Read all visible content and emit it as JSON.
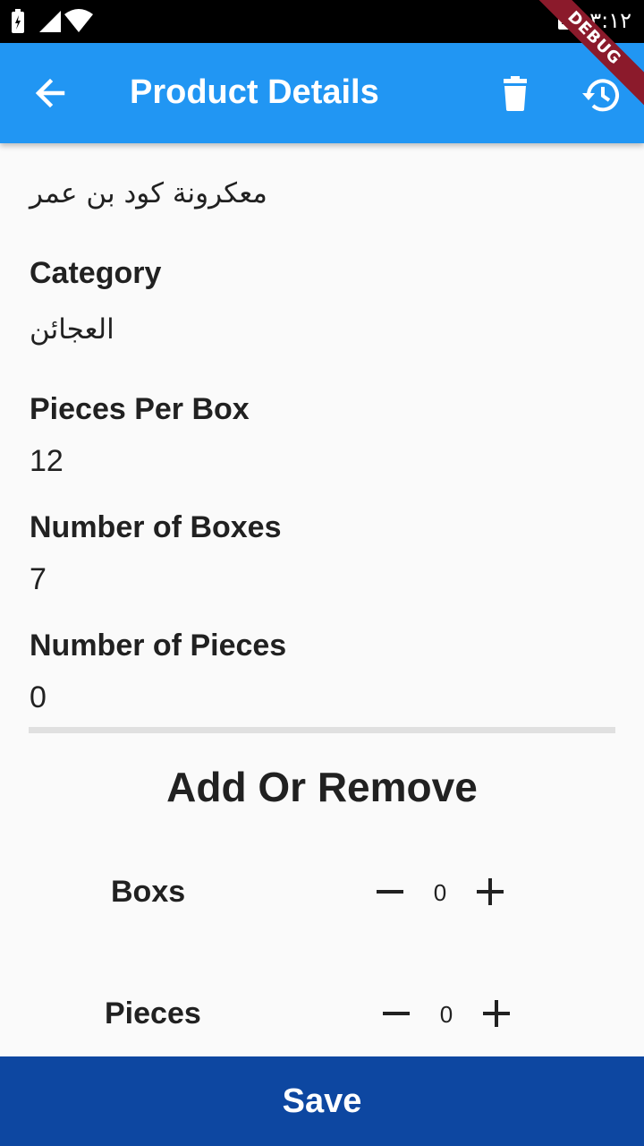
{
  "status_bar": {
    "time": "٣:١٢",
    "icons": [
      "battery-charging-icon",
      "signal-icon",
      "wifi-icon",
      "accessibility-a-icon"
    ],
    "a_glyph": "A"
  },
  "debug_banner": "DEBUG",
  "appbar": {
    "title": "Product Details",
    "color": "#2196f3",
    "icons": [
      "back-arrow-icon",
      "trash-icon",
      "history-icon"
    ]
  },
  "product": {
    "name": "معكرونة كود بن عمر",
    "category_label": "Category",
    "category_value": "العجائن",
    "pieces_per_box_label": "Pieces Per Box",
    "pieces_per_box_value": "12",
    "number_of_boxes_label": "Number of Boxes",
    "number_of_boxes_value": "7",
    "number_of_pieces_label": "Number of Pieces",
    "number_of_pieces_value": "0"
  },
  "adjust": {
    "title": "Add Or Remove",
    "boxes_label": "Boxs",
    "boxes_value": "0",
    "pieces_label": "Pieces",
    "pieces_value": "0"
  },
  "save_label": "Save",
  "save_color": "#0d47a1"
}
